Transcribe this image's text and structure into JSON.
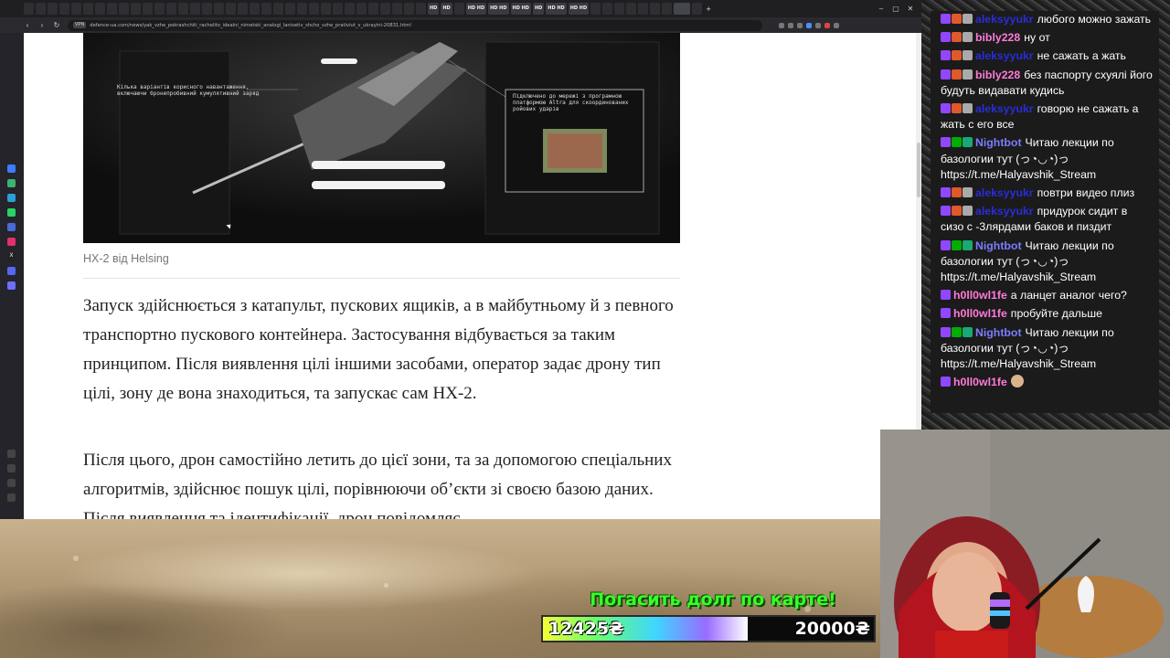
{
  "browser": {
    "tabs": [
      "",
      "",
      "",
      "",
      "",
      "",
      "",
      "",
      "",
      "",
      "",
      "",
      "",
      "",
      "",
      "",
      "",
      "",
      "",
      "",
      "",
      "",
      "",
      "",
      "",
      "",
      "",
      "",
      "",
      "",
      "",
      "",
      "",
      "",
      "HD",
      "HD",
      "",
      "HD HD",
      "HD HD",
      "HD HD",
      "HD",
      "HD HD",
      "HD HD",
      "",
      "",
      "",
      "",
      "",
      "",
      "",
      "",
      ""
    ],
    "url": "defence-ua.com/news/yak_vzhe_pokrashchiti_rachelito_idealni_nimetski_analogi_lanisetiv_shcho_vzhe_prativiut_v_ukrayini-20831.html",
    "vpn_label": "VPN"
  },
  "article": {
    "figure_callout_left": "Кілька варіантів корисного навантаження, включаючи бронепробивний кумулятивний заряд",
    "figure_callout_right": "Підключено до мережі з програмною платформою Altra для скоординованих ройових ударів",
    "caption": "HX-2 від Helsing",
    "paragraph1": "Запуск здійснюється з катапульт, пускових ящиків, а в майбутньому й з певного транспортно пускового контейнера. Застосування відбувається за таким принципом. Після виявлення цілі іншими засобами, оператор задає дрону тип цілі, зону де вона знаходиться, та запускає сам HX-2.",
    "paragraph2": "Після цього, дрон самостійно летить до цієї зони, та за допомогою спеціальних алгоритмів, здійснює пошук цілі, порівнюючи об’єкти зі своєю базою даних. Після виявлення та ідентифікації, дрон повідомляє"
  },
  "chat": {
    "messages": [
      {
        "user": "aleksyyukr",
        "color": "#2a2dd6",
        "badges": [
          "#9147ff",
          "#e0592a",
          "#aaaaaa"
        ],
        "text": "любого можно зажать"
      },
      {
        "user": "bibly228",
        "color": "#ff7ad9",
        "badges": [
          "#9147ff",
          "#e0592a",
          "#aaaaaa"
        ],
        "text": "ну от"
      },
      {
        "user": "aleksyyukr",
        "color": "#2a2dd6",
        "badges": [
          "#9147ff",
          "#e0592a",
          "#aaaaaa"
        ],
        "text": "не сажать а жать"
      },
      {
        "user": "bibly228",
        "color": "#ff7ad9",
        "badges": [
          "#9147ff",
          "#e0592a",
          "#aaaaaa"
        ],
        "text": "без паспорту схуялі його будуть видавати кудись"
      },
      {
        "user": "aleksyyukr",
        "color": "#2a2dd6",
        "badges": [
          "#9147ff",
          "#e0592a",
          "#aaaaaa"
        ],
        "text": "говорю не сажать а жать с его все"
      },
      {
        "user": "Nightbot",
        "color": "#7c7cff",
        "badges": [
          "#9147ff",
          "#00ad03",
          "#19a974"
        ],
        "text": "Читаю лекции по базологии тут (っ◔◡◔)っ https://t.me/Halyavshik_Stream"
      },
      {
        "user": "aleksyyukr",
        "color": "#2a2dd6",
        "badges": [
          "#9147ff",
          "#e0592a",
          "#aaaaaa"
        ],
        "text": "повтри видео плиз"
      },
      {
        "user": "aleksyyukr",
        "color": "#2a2dd6",
        "badges": [
          "#9147ff",
          "#e0592a",
          "#aaaaaa"
        ],
        "text": "придурок сидит в сизо с -3лярдами баков и пиздит"
      },
      {
        "user": "Nightbot",
        "color": "#7c7cff",
        "badges": [
          "#9147ff",
          "#00ad03",
          "#19a974"
        ],
        "text": "Читаю лекции по базологии тут (っ◔◡◔)っ https://t.me/Halyavshik_Stream"
      },
      {
        "user": "h0ll0wl1fe",
        "color": "#ff7ad9",
        "badges": [
          "#9147ff"
        ],
        "text": "а ланцет аналог чего?"
      },
      {
        "user": "h0ll0wl1fe",
        "color": "#ff7ad9",
        "badges": [
          "#9147ff"
        ],
        "text": "пробуйте дальше"
      },
      {
        "user": "Nightbot",
        "color": "#7c7cff",
        "badges": [
          "#9147ff",
          "#00ad03",
          "#19a974"
        ],
        "text": "Читаю лекции по базологии тут (っ◔◡◔)っ https://t.me/Halyavshik_Stream"
      },
      {
        "user": "h0ll0wl1fe",
        "color": "#ff7ad9",
        "badges": [
          "#9147ff"
        ],
        "text": "",
        "emote": true
      }
    ]
  },
  "donation_goal": {
    "title": "Погасить долг по карте!",
    "current": "12425₴",
    "target": "20000₴",
    "progress_fraction": 0.62
  }
}
